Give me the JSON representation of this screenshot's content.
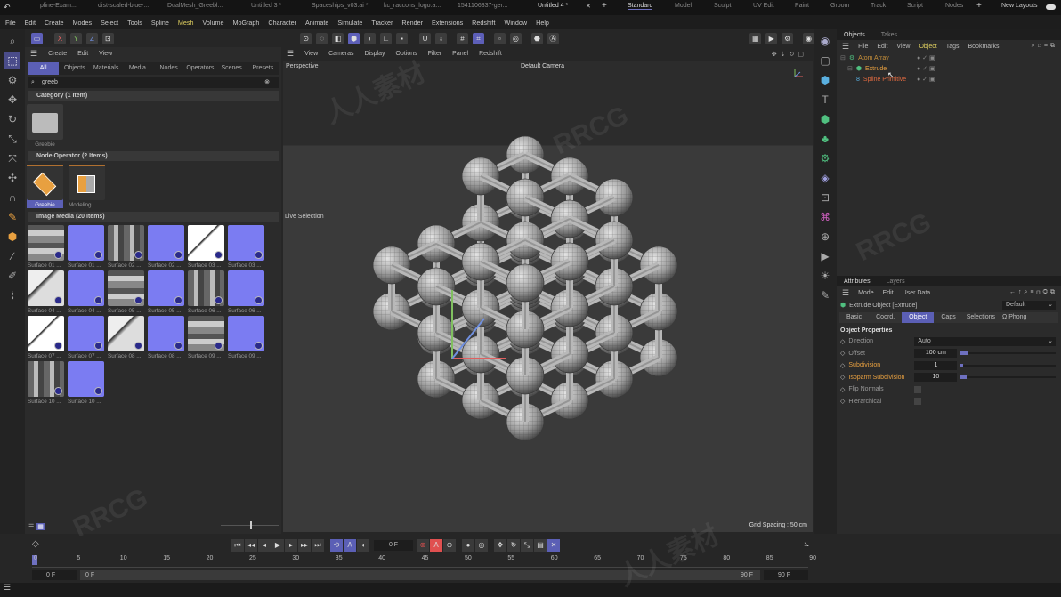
{
  "file_tabs": [
    "pline-Exam...",
    "dist-scaled-blue-...",
    "DualMesh_Greebl...",
    "Untitled 3 *",
    "Spaceships_v03.ai *",
    "kc_raccons_logo.a...",
    "1541106337-ger...",
    "Untitled 4 *"
  ],
  "layout_tabs": [
    "Standard",
    "Model",
    "Sculpt",
    "UV Edit",
    "Paint",
    "Groom",
    "Track",
    "Script",
    "Nodes"
  ],
  "new_layouts": "New Layouts",
  "menu": [
    "File",
    "Edit",
    "Create",
    "Modes",
    "Select",
    "Tools",
    "Spline",
    "Mesh",
    "Volume",
    "MoGraph",
    "Character",
    "Animate",
    "Simulate",
    "Tracker",
    "Render",
    "Extensions",
    "Redshift",
    "Window",
    "Help"
  ],
  "axis_buttons": [
    "X",
    "Y",
    "Z"
  ],
  "assets": {
    "menu": [
      "Create",
      "Edit",
      "View"
    ],
    "filters": [
      "All",
      "Objects",
      "Materials",
      "Media",
      "Nodes",
      "Operators",
      "Scenes",
      "Presets"
    ],
    "search_value": "greeb",
    "category_header": "Category (1 Item)",
    "category_items": [
      "Greebie"
    ],
    "node_header": "Node Operator (2 Items)",
    "node_items": [
      "Greebie",
      "Modeling ..."
    ],
    "media_header": "Image Media (20 Items)",
    "media_items": [
      "Surface 01 ...",
      "Surface 01 ...",
      "Surface 02 ...",
      "Surface 02 ...",
      "Surface 03 ...",
      "Surface 03 ...",
      "Surface 04 ...",
      "Surface 04 ...",
      "Surface 05 ...",
      "Surface 05 ...",
      "Surface 06 ...",
      "Surface 06 ...",
      "Surface 07 ...",
      "Surface 07 ...",
      "Surface 08 ...",
      "Surface 08 ...",
      "Surface 09 ...",
      "Surface 09 ...",
      "Surface 10 ...",
      "Surface 10 ..."
    ]
  },
  "viewport": {
    "menu": [
      "View",
      "Cameras",
      "Display",
      "Options",
      "Filter",
      "Panel",
      "Redshift"
    ],
    "name": "Perspective",
    "camera": "Default Camera",
    "live_selection": "Live Selection",
    "grid_spacing": "Grid Spacing : 50 cm"
  },
  "objects": {
    "tabs": [
      "Objects",
      "Takes"
    ],
    "menu": [
      "File",
      "Edit",
      "View",
      "Object",
      "Tags",
      "Bookmarks"
    ],
    "tree": [
      "Atom Array",
      "Extrude",
      "Spline Primitive"
    ]
  },
  "attributes": {
    "tabs": [
      "Attributes",
      "Layers"
    ],
    "menu": [
      "Mode",
      "Edit",
      "User Data"
    ],
    "object_title": "Extrude Object [Extrude]",
    "preset": "Default",
    "subtabs": [
      "Basic",
      "Coord.",
      "Object",
      "Caps",
      "Selections",
      "Phong"
    ],
    "section": "Object Properties",
    "direction_label": "Direction",
    "direction_value": "Auto",
    "offset_label": "Offset",
    "offset_value": "100 cm",
    "offset_fill": 0.08,
    "subdivision_label": "Subdivision",
    "subdivision_value": "1",
    "subdivision_fill": 0.0,
    "isoparm_label": "Isoparm Subdivision",
    "isoparm_value": "10",
    "isoparm_fill": 0.06,
    "flip_label": "Flip Normals",
    "flip_checked": false,
    "hier_label": "Hierarchical",
    "hier_checked": false
  },
  "timeline": {
    "current_frame": "0 F",
    "ticks": [
      "0",
      "5",
      "10",
      "15",
      "20",
      "25",
      "30",
      "35",
      "40",
      "45",
      "50",
      "55",
      "60",
      "65",
      "70",
      "75",
      "80",
      "85",
      "90"
    ],
    "start": "0 F",
    "range_start": "0 F",
    "range_end": "90 F",
    "end": "90 F"
  },
  "colors": {
    "accent": "#5b5fb5",
    "orange": "#e8a040",
    "record": "#e05050"
  }
}
